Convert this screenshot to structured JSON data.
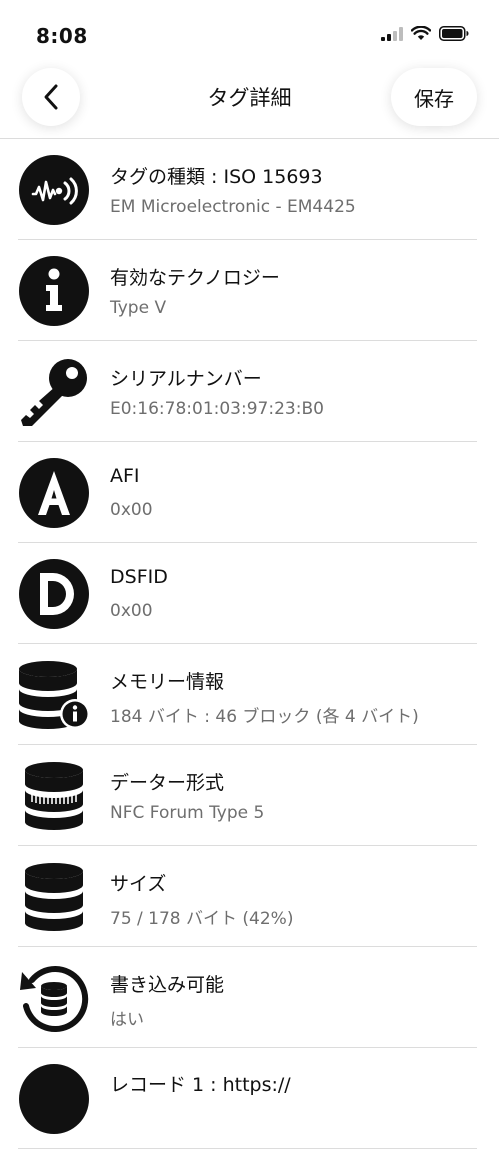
{
  "status_bar": {
    "time": "8:08"
  },
  "header": {
    "title": "タグ詳細",
    "save_label": "保存"
  },
  "items": [
    {
      "label": "タグの種類 : ISO 15693",
      "value": "EM Microelectronic - EM4425",
      "icon": "nfc-tag-icon"
    },
    {
      "label": "有効なテクノロジー",
      "value": "Type V",
      "icon": "info-icon"
    },
    {
      "label": "シリアルナンバー",
      "value": "E0:16:78:01:03:97:23:B0",
      "icon": "key-icon"
    },
    {
      "label": "AFI",
      "value": "0x00",
      "icon": "letter-a-icon"
    },
    {
      "label": "DSFID",
      "value": "0x00",
      "icon": "letter-d-icon"
    },
    {
      "label": "メモリー情報",
      "value": "184 バイト : 46 ブロック (各 4 バイト)",
      "icon": "database-info-icon"
    },
    {
      "label": "データー形式",
      "value": "NFC Forum Type 5",
      "icon": "database-format-icon"
    },
    {
      "label": "サイズ",
      "value": "75 / 178 バイト (42%)",
      "icon": "database-icon"
    },
    {
      "label": "書き込み可能",
      "value": "はい",
      "icon": "database-refresh-icon"
    },
    {
      "label": "レコード 1 : https://",
      "value": "",
      "icon": "record-icon"
    }
  ]
}
